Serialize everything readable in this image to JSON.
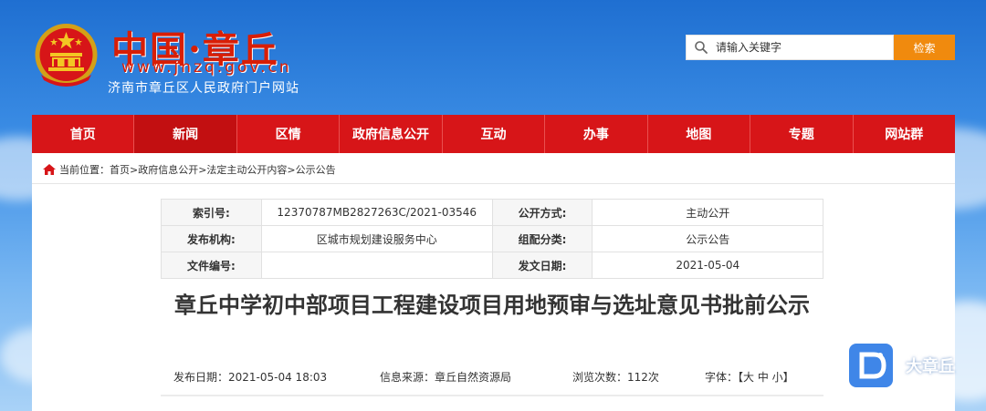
{
  "header": {
    "site_name": "中国·章丘",
    "site_url": "www.jnzq.gov.cn",
    "site_subtitle": "济南市章丘区人民政府门户网站"
  },
  "search": {
    "placeholder": "请输入关键字",
    "button_label": "检索"
  },
  "nav": {
    "items": [
      "首页",
      "新闻",
      "区情",
      "政府信息公开",
      "互动",
      "办事",
      "地图",
      "专题",
      "网站群"
    ],
    "active_index": 1
  },
  "breadcrumb": {
    "text": "当前位置：首页>政府信息公开>法定主动公开内容>公示公告"
  },
  "meta": {
    "index_label": "索引号:",
    "index_value": "12370787MB2827263C/2021-03546",
    "open_method_label": "公开方式:",
    "open_method_value": "主动公开",
    "publisher_label": "发布机构:",
    "publisher_value": "区城市规划建设服务中心",
    "category_label": "组配分类:",
    "category_value": "公示公告",
    "doc_no_label": "文件编号:",
    "doc_no_value": "",
    "date_label": "发文日期:",
    "date_value": "2021-05-04"
  },
  "article": {
    "title": "章丘中学初中部项目工程建设项目用地预审与选址意见书批前公示",
    "publish_date": "发布日期：2021-05-04 18:03",
    "source": "信息来源：章丘自然资源局",
    "views": "浏览次数：112次",
    "font_size": "字体：【大 中 小】"
  },
  "watermark": {
    "text": "大章丘"
  },
  "colors": {
    "nav_red": "#d71518",
    "title_red": "#d81e06",
    "search_orange": "#f08a0e"
  }
}
